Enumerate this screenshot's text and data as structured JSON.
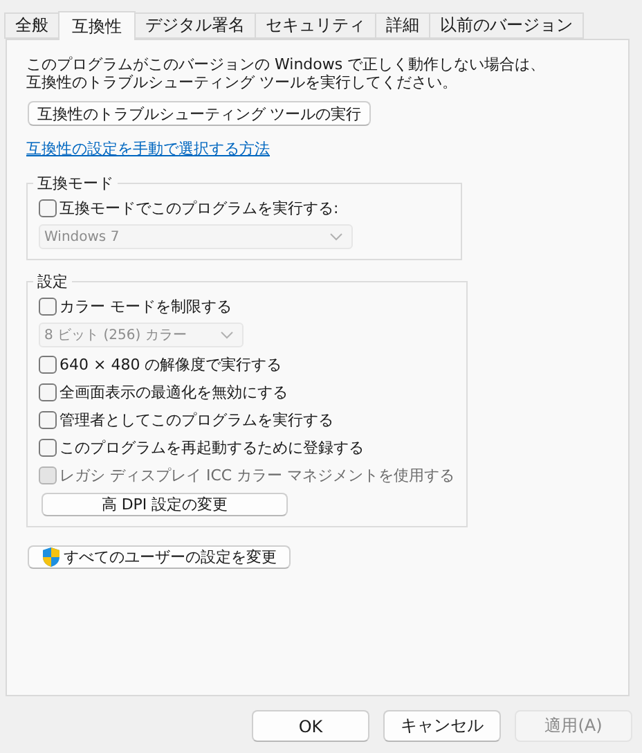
{
  "tabs": [
    {
      "label": "全般",
      "selected": false
    },
    {
      "label": "互換性",
      "selected": true
    },
    {
      "label": "デジタル署名",
      "selected": false
    },
    {
      "label": "セキュリティ",
      "selected": false
    },
    {
      "label": "詳細",
      "selected": false
    },
    {
      "label": "以前のバージョン",
      "selected": false
    }
  ],
  "description": "このプログラムがこのバージョンの Windows で正しく動作しない場合は、互換性のトラブルシューティング ツールを実行してください。",
  "troubleshoot_button": "互換性のトラブルシューティング ツールの実行",
  "help_link": "互換性の設定を手動で選択する方法",
  "compat_mode": {
    "title": "互換モード",
    "checkbox": {
      "label": "互換モードでこのプログラムを実行する:",
      "checked": false,
      "disabled": false
    },
    "dropdown": {
      "value": "Windows 7",
      "disabled": true
    }
  },
  "settings": {
    "title": "設定",
    "items": [
      {
        "kind": "checkbox",
        "label": "カラー モードを制限する",
        "checked": false,
        "disabled": false
      },
      {
        "kind": "dropdown",
        "value": "8 ビット (256) カラー",
        "disabled": true
      },
      {
        "kind": "checkbox",
        "label": "640 × 480 の解像度で実行する",
        "checked": false,
        "disabled": false
      },
      {
        "kind": "checkbox",
        "label": "全画面表示の最適化を無効にする",
        "checked": false,
        "disabled": false
      },
      {
        "kind": "checkbox",
        "label": "管理者としてこのプログラムを実行する",
        "checked": false,
        "disabled": false
      },
      {
        "kind": "checkbox",
        "label": "このプログラムを再起動するために登録する",
        "checked": false,
        "disabled": false
      },
      {
        "kind": "checkbox",
        "label": "レガシ ディスプレイ ICC カラー マネジメントを使用する",
        "checked": false,
        "disabled": true
      },
      {
        "kind": "button",
        "label": "高 DPI 設定の変更"
      }
    ]
  },
  "all_users_button": "すべてのユーザーの設定を変更",
  "footer_buttons": [
    {
      "label": "OK",
      "disabled": false
    },
    {
      "label": "キャンセル",
      "disabled": false
    },
    {
      "label": "適用(A)",
      "disabled": true
    }
  ]
}
